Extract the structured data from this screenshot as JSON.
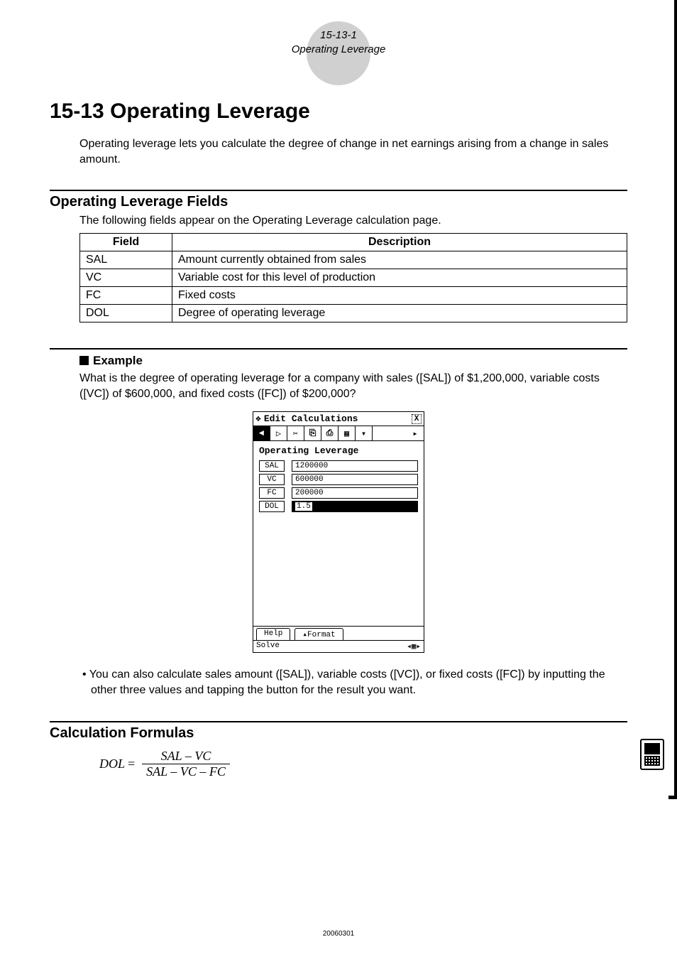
{
  "header": {
    "pageno": "15-13-1",
    "section": "Operating Leverage"
  },
  "title": "15-13  Operating Leverage",
  "intro": "Operating leverage lets you calculate the degree of change in net earnings arising from a change in sales amount.",
  "fields_section": {
    "heading": "Operating Leverage Fields",
    "lead": "The following fields appear on the Operating Leverage calculation page.",
    "col_field": "Field",
    "col_desc": "Description",
    "rows": [
      {
        "f": "SAL",
        "d": "Amount currently obtained from sales"
      },
      {
        "f": "VC",
        "d": "Variable cost for this level of production"
      },
      {
        "f": "FC",
        "d": "Fixed costs"
      },
      {
        "f": "DOL",
        "d": "Degree of operating leverage"
      }
    ]
  },
  "example": {
    "label": "Example",
    "text": "What is the degree of operating leverage for a company with sales ([SAL]) of $1,200,000, variable costs ([VC]) of $600,000, and fixed costs ([FC]) of $200,000?"
  },
  "calc": {
    "menubar": "Edit Calculations",
    "title": "Operating Leverage",
    "rows": {
      "sal_label": "SAL",
      "sal_val": "1200000",
      "vc_label": "VC",
      "vc_val": "600000",
      "fc_label": "FC",
      "fc_val": "200000",
      "dol_label": "DOL",
      "dol_val": "1.5"
    },
    "tabs": {
      "help": "Help",
      "format": "▴Format"
    },
    "status_left": "Solve",
    "toolbar": {
      "prev": "◄",
      "next": "▷",
      "cut": "✂",
      "copy": "⎘",
      "paste": "⎙",
      "grid": "▦",
      "dd": "▾",
      "more": "▸"
    }
  },
  "note": "• You can also calculate sales amount ([SAL]), variable costs ([VC]), or fixed costs ([FC]) by inputting the other three values and tapping the button for the result you want.",
  "formulas": {
    "heading": "Calculation Formulas",
    "lhs": "DOL",
    "eq": "=",
    "num": "SAL – VC",
    "den": "SAL – VC – FC"
  },
  "footer": "20060301"
}
